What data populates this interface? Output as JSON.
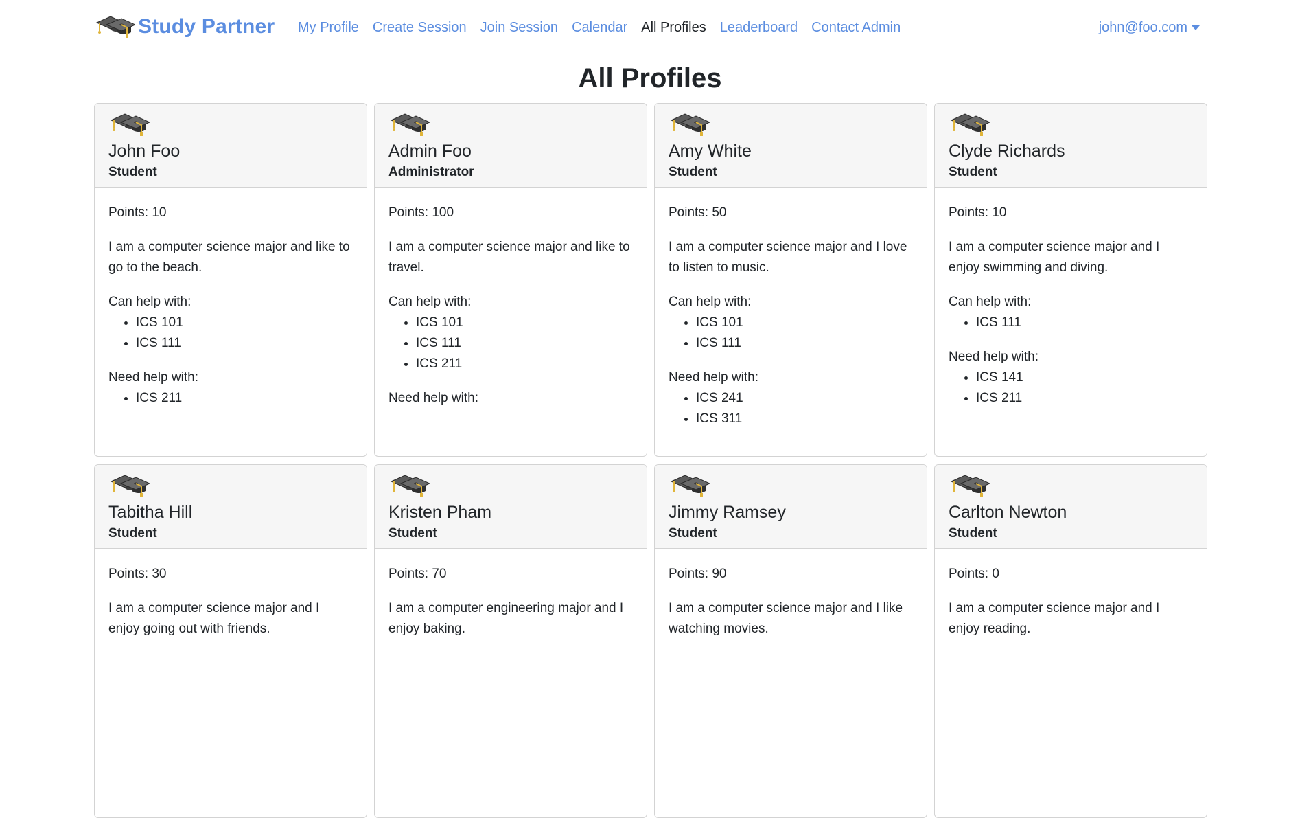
{
  "nav": {
    "brand": "Study Partner",
    "links": [
      {
        "label": "My Profile",
        "active": false
      },
      {
        "label": "Create Session",
        "active": false
      },
      {
        "label": "Join Session",
        "active": false
      },
      {
        "label": "Calendar",
        "active": false
      },
      {
        "label": "All Profiles",
        "active": true
      },
      {
        "label": "Leaderboard",
        "active": false
      },
      {
        "label": "Contact Admin",
        "active": false
      }
    ],
    "user": "john@foo.com"
  },
  "page": {
    "title": "All Profiles"
  },
  "labels": {
    "can_help": "Can help with:",
    "need_help": "Need help with:"
  },
  "colors": {
    "accent": "#5b8de0",
    "card_header_bg": "#f6f6f6",
    "border": "#d3d3d3"
  },
  "profiles": [
    {
      "name": "John Foo",
      "role": "Student",
      "points": "Points: 10",
      "bio": "I am a computer science major and like to go to the beach.",
      "can_help": [
        "ICS 101",
        "ICS 111"
      ],
      "need_help": [
        "ICS 211"
      ]
    },
    {
      "name": "Admin Foo",
      "role": "Administrator",
      "points": "Points: 100",
      "bio": "I am a computer science major and like to travel.",
      "can_help": [
        "ICS 101",
        "ICS 111",
        "ICS 211"
      ],
      "need_help": []
    },
    {
      "name": "Amy White",
      "role": "Student",
      "points": "Points: 50",
      "bio": "I am a computer science major and I love to listen to music.",
      "can_help": [
        "ICS 101",
        "ICS 111"
      ],
      "need_help": [
        "ICS 241",
        "ICS 311"
      ]
    },
    {
      "name": "Clyde Richards",
      "role": "Student",
      "points": "Points: 10",
      "bio": "I am a computer science major and I enjoy swimming and diving.",
      "can_help": [
        "ICS 111"
      ],
      "need_help": [
        "ICS 141",
        "ICS 211"
      ]
    },
    {
      "name": "Tabitha Hill",
      "role": "Student",
      "points": "Points: 30",
      "bio": "I am a computer science major and I enjoy going out with friends.",
      "can_help": [],
      "need_help": []
    },
    {
      "name": "Kristen Pham",
      "role": "Student",
      "points": "Points: 70",
      "bio": "I am a computer engineering major and I enjoy baking.",
      "can_help": [],
      "need_help": []
    },
    {
      "name": "Jimmy Ramsey",
      "role": "Student",
      "points": "Points: 90",
      "bio": "I am a computer science major and I like watching movies.",
      "can_help": [],
      "need_help": []
    },
    {
      "name": "Carlton Newton",
      "role": "Student",
      "points": "Points: 0",
      "bio": "I am a computer science major and I enjoy reading.",
      "can_help": [],
      "need_help": []
    }
  ]
}
